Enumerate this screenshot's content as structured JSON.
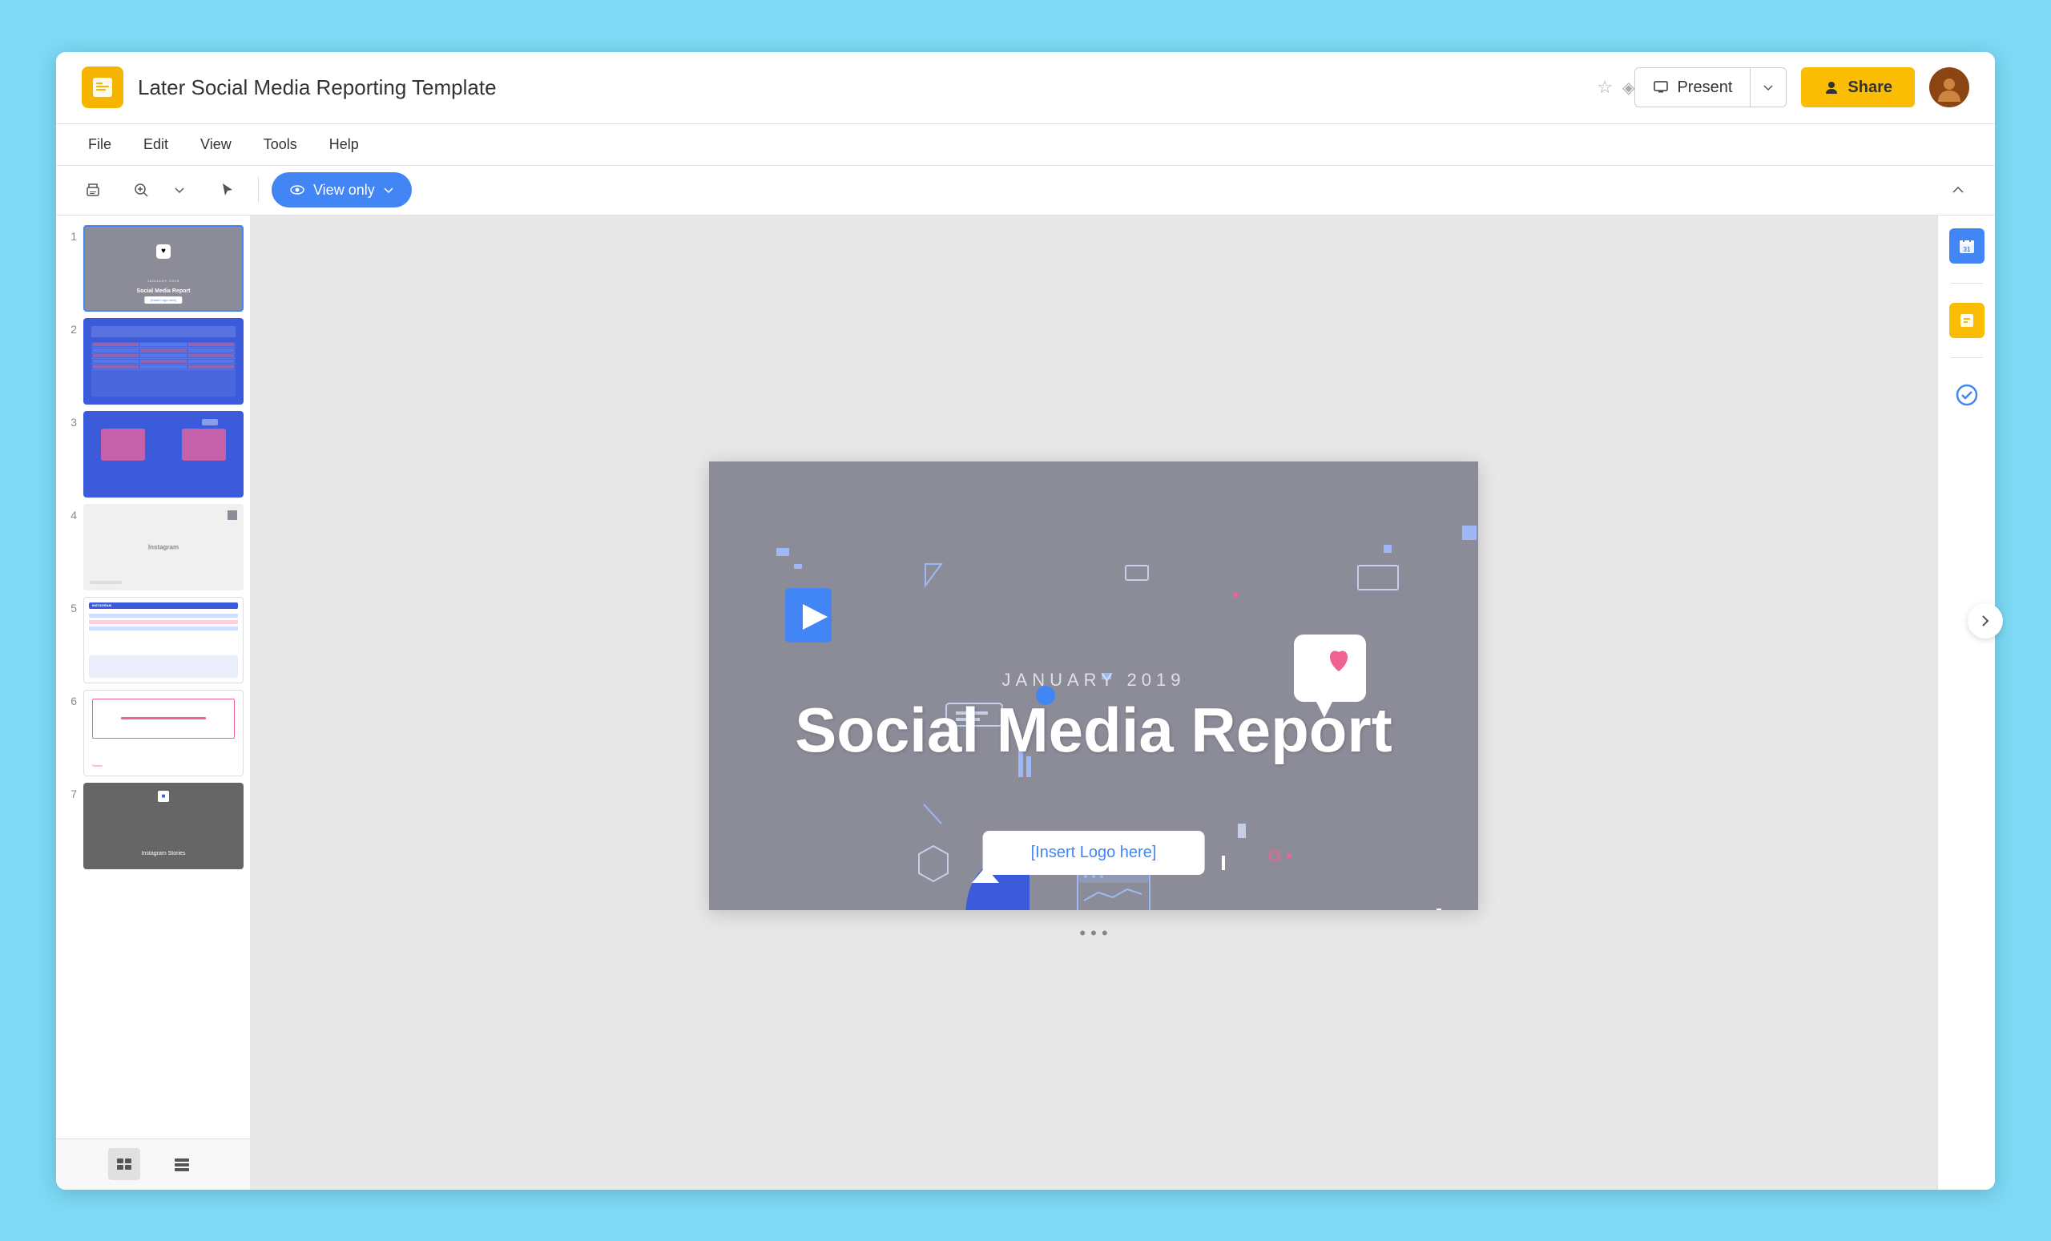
{
  "app": {
    "title": "Later Social Media Reporting Template",
    "logo_color": "#f4b400"
  },
  "header": {
    "title": "Later Social Media Reporting Template",
    "present_label": "Present",
    "share_label": "Share",
    "star_icon": "☆",
    "drive_icon": "◈"
  },
  "menubar": {
    "items": [
      "File",
      "Edit",
      "View",
      "Tools",
      "Help"
    ]
  },
  "toolbar": {
    "print_icon": "🖨",
    "zoom_icon": "⊕",
    "cursor_icon": "↖",
    "view_only_label": "View only",
    "eye_icon": "👁"
  },
  "slides": [
    {
      "number": "1",
      "active": true,
      "bg": "#8c8c99",
      "type": "cover"
    },
    {
      "number": "2",
      "active": false,
      "bg": "#3b5bdb",
      "type": "table"
    },
    {
      "number": "3",
      "active": false,
      "bg": "#3b5bdb",
      "type": "boxes"
    },
    {
      "number": "4",
      "active": false,
      "bg": "#e8e8e8",
      "type": "instagram"
    },
    {
      "number": "5",
      "active": false,
      "bg": "#ffffff",
      "type": "data"
    },
    {
      "number": "6",
      "active": false,
      "bg": "#ffffff",
      "type": "pink"
    },
    {
      "number": "7",
      "active": false,
      "bg": "#666666",
      "type": "stories"
    }
  ],
  "main_slide": {
    "date_label": "JANUARY 2019",
    "title": "Social Media Report",
    "logo_placeholder": "[Insert Logo here]",
    "heart_emoji": "♥"
  },
  "right_panel": {
    "calendar_icon": "📅",
    "tasks_icon": "✓",
    "check_icon": "✓"
  },
  "view_modes": {
    "list_label": "List view",
    "grid_label": "Grid view"
  },
  "slide_dots": "• • •",
  "colors": {
    "accent_blue": "#4285f4",
    "accent_yellow": "#fbbc04",
    "slide_bg": "#8c8c99",
    "slide_blue": "#3b5bdb",
    "pink": "#f06292",
    "white": "#ffffff"
  }
}
